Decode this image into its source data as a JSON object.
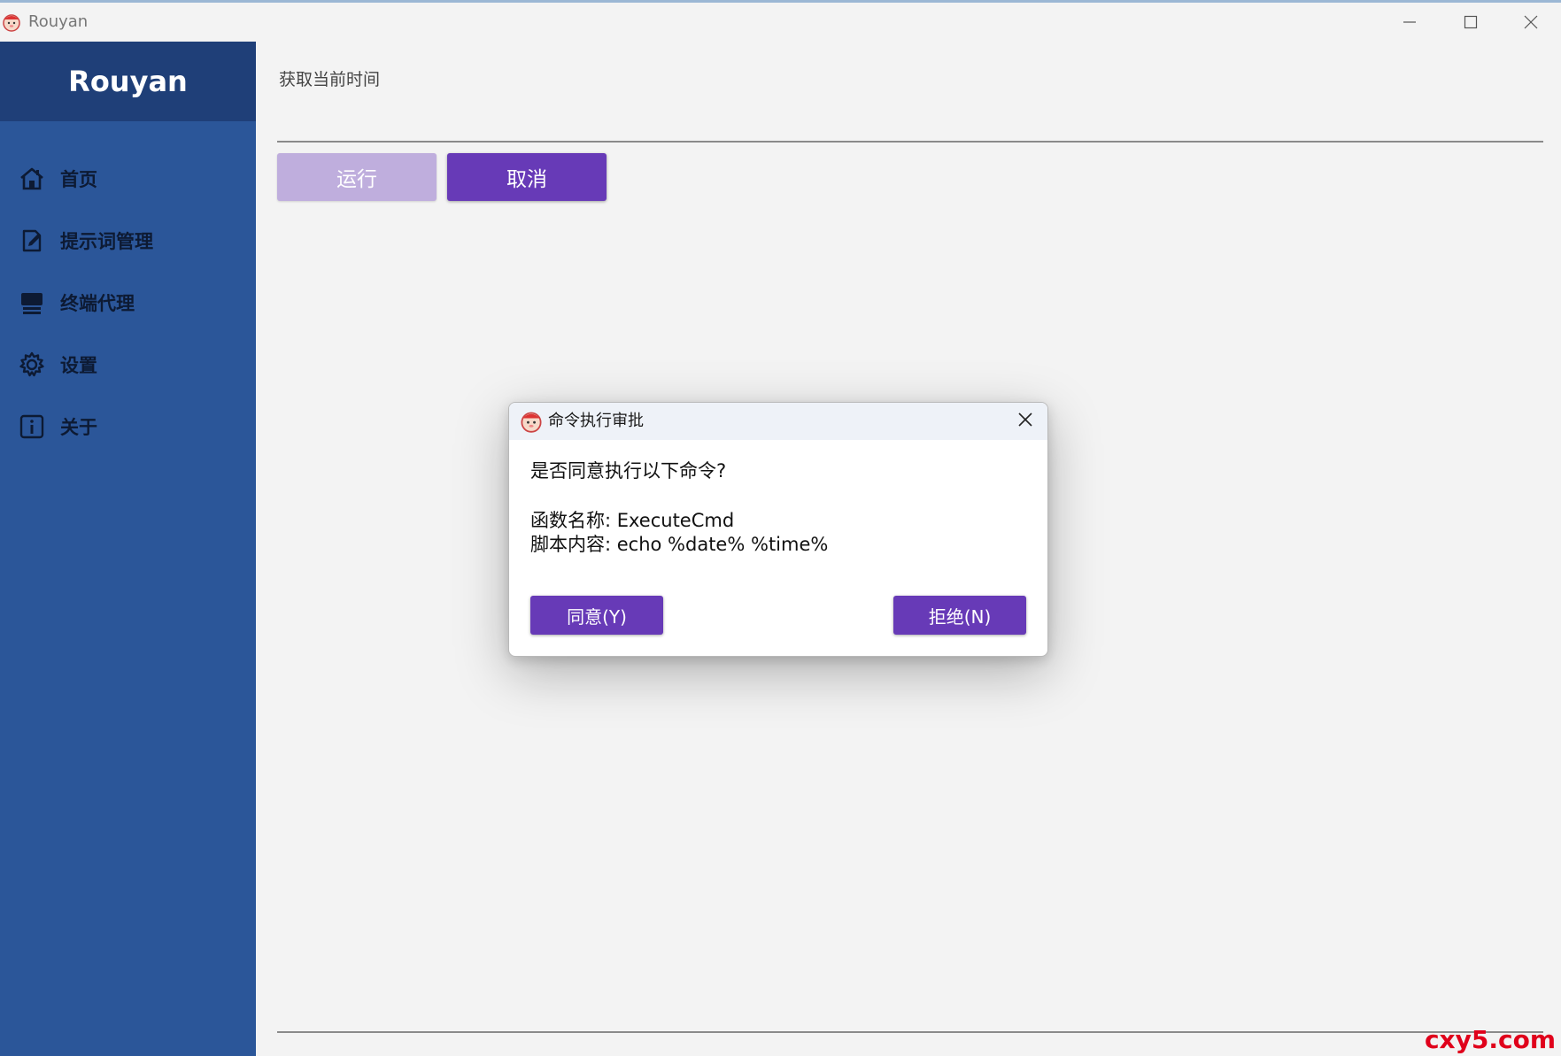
{
  "window": {
    "title": "Rouyan",
    "controls": [
      "minimize-icon",
      "maximize-icon",
      "close-icon"
    ]
  },
  "sidebar": {
    "brand": "Rouyan",
    "items": [
      {
        "label": "首页",
        "icon": "home-icon"
      },
      {
        "label": "提示词管理",
        "icon": "edit-document-icon"
      },
      {
        "label": "终端代理",
        "icon": "terminal-icon"
      },
      {
        "label": "设置",
        "icon": "gear-icon"
      },
      {
        "label": "关于",
        "icon": "info-icon"
      }
    ]
  },
  "main": {
    "command_input_value": "获取当前时间",
    "run_label": "运行",
    "cancel_label": "取消"
  },
  "dialog": {
    "title": "命令执行审批",
    "question": "是否同意执行以下命令?",
    "function_line": "函数名称: ExecuteCmd",
    "script_line": "脚本内容: echo %date% %time%",
    "agree_label": "同意(Y)",
    "reject_label": "拒绝(N)"
  },
  "watermark": "cxy5.com",
  "colors": {
    "sidebar": "#2b5699",
    "brand_bg": "#1f3f78",
    "accent": "#673ab7",
    "accent_disabled": "#bfaedd",
    "watermark": "#e0001b"
  }
}
